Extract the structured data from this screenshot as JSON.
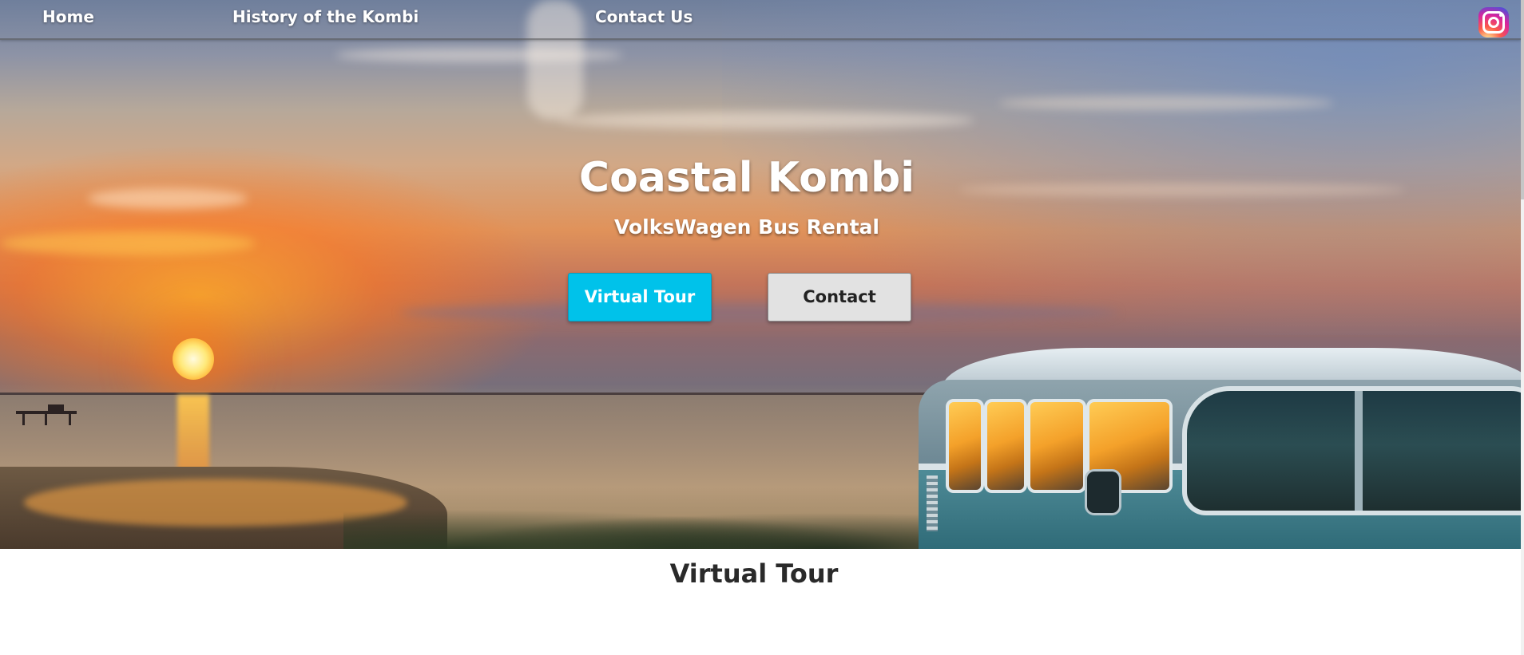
{
  "nav": {
    "home": "Home",
    "history": "History of the Kombi",
    "contact": "Contact Us",
    "social_icon": "instagram-icon"
  },
  "hero": {
    "title": "Coastal Kombi",
    "subtitle": "VolksWagen Bus Rental",
    "primary_button": "Virtual Tour",
    "secondary_button": "Contact"
  },
  "section": {
    "title": "Virtual Tour"
  },
  "colors": {
    "primary_button_bg": "#00c2ea",
    "secondary_button_bg": "#e2e2e2",
    "heading_text": "#2a2a2a",
    "instagram_gradient": [
      "#fdf497",
      "#fd5949",
      "#d6249f",
      "#285AEB"
    ]
  }
}
